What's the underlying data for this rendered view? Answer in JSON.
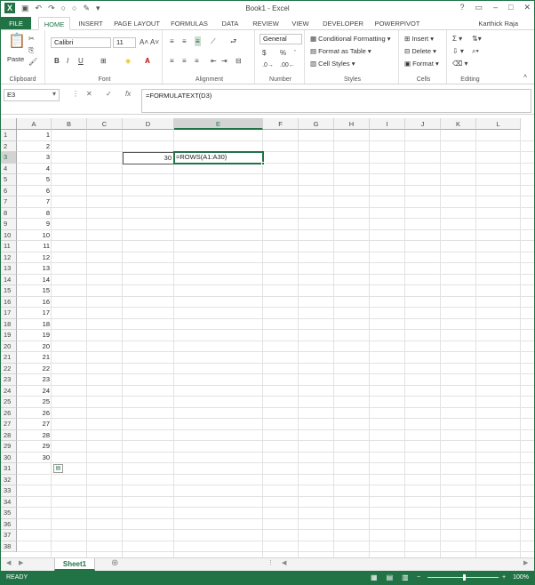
{
  "window": {
    "title": "Book1 - Excel",
    "user": "Karthick Raja"
  },
  "tabs": [
    "FILE",
    "HOME",
    "INSERT",
    "PAGE LAYOUT",
    "FORMULAS",
    "DATA",
    "REVIEW",
    "VIEW",
    "DEVELOPER",
    "POWERPIVOT"
  ],
  "ribbon": {
    "clipboard": {
      "label": "Clipboard",
      "paste": "Paste"
    },
    "font": {
      "label": "Font",
      "name": "Calibri",
      "size": "11",
      "bold": "B",
      "italic": "I",
      "underline": "U",
      "grow": "A˄",
      "shrink": "A˅"
    },
    "alignment": {
      "label": "Alignment"
    },
    "number": {
      "label": "Number",
      "format": "General",
      "currency": "$",
      "percent": "%",
      "comma": "’"
    },
    "styles": {
      "label": "Styles",
      "cond": "Conditional Formatting",
      "table": "Format as Table",
      "cell": "Cell Styles"
    },
    "cells": {
      "label": "Cells",
      "insert": "Insert",
      "delete": "Delete",
      "format": "Format"
    },
    "editing": {
      "label": "Editing"
    }
  },
  "formula_bar": {
    "name_box": "E3",
    "fx": "fx",
    "formula": "=FORMULATEXT(D3)"
  },
  "columns": [
    "A",
    "B",
    "C",
    "D",
    "E",
    "F",
    "G",
    "H",
    "I",
    "J",
    "K",
    "L"
  ],
  "rows": [
    "1",
    "2",
    "3",
    "4",
    "5",
    "6",
    "7",
    "8",
    "9",
    "10",
    "11",
    "12",
    "13",
    "14",
    "15",
    "16",
    "17",
    "18",
    "19",
    "20",
    "21",
    "22",
    "23",
    "24",
    "25",
    "26",
    "27",
    "28",
    "29",
    "30",
    "31",
    "32",
    "33",
    "34",
    "35",
    "36",
    "37",
    "38"
  ],
  "col_a_values": [
    "1",
    "2",
    "3",
    "4",
    "5",
    "6",
    "7",
    "8",
    "9",
    "10",
    "11",
    "12",
    "13",
    "14",
    "15",
    "16",
    "17",
    "18",
    "19",
    "20",
    "21",
    "22",
    "23",
    "24",
    "25",
    "26",
    "27",
    "28",
    "29",
    "30"
  ],
  "cells": {
    "D3": "30",
    "E3": "=ROWS(A1:A30)"
  },
  "sheets": [
    "Sheet1"
  ],
  "status": {
    "mode": "READY",
    "zoom": "100%"
  }
}
